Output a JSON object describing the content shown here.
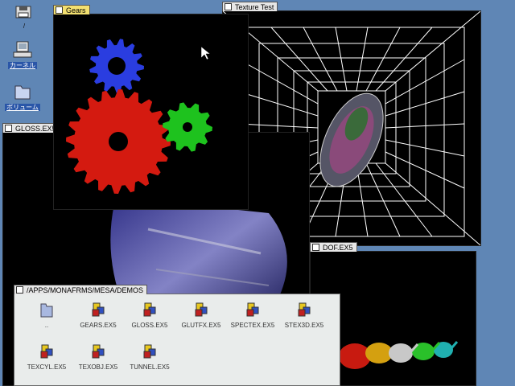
{
  "desktop": {
    "icons": [
      {
        "name": "floppy-icon",
        "label": "/"
      },
      {
        "name": "computer-icon",
        "label": "カーネル"
      },
      {
        "name": "folder-icon",
        "label": "ボリューム"
      }
    ]
  },
  "windows": {
    "gears": {
      "title": "Gears"
    },
    "texture": {
      "title": "Texture Test"
    },
    "gloss": {
      "title": "GLOSS.EX5"
    },
    "dof": {
      "title": "DOF.EX5"
    }
  },
  "filer": {
    "title": "/APPS/MONAFRMS/MESA/DEMOS",
    "items": [
      {
        "label": "..",
        "icon": "folder-icon"
      },
      {
        "label": "GEARS.EX5",
        "icon": "app-icon"
      },
      {
        "label": "GLOSS.EX5",
        "icon": "app-icon"
      },
      {
        "label": "GLUTFX.EX5",
        "icon": "app-icon"
      },
      {
        "label": "SPECTEX.EX5",
        "icon": "app-icon"
      },
      {
        "label": "STEX3D.EX5",
        "icon": "app-icon"
      },
      {
        "label": "TEXCYL.EX5",
        "icon": "app-icon"
      },
      {
        "label": "TEXOBJ.EX5",
        "icon": "app-icon"
      },
      {
        "label": "TUNNEL.EX5",
        "icon": "app-icon"
      }
    ]
  },
  "colors": {
    "desktop": "#5f86b5",
    "gear_blue": "#2a3de0",
    "gear_red": "#d41a10",
    "gear_green": "#1ec21e"
  }
}
